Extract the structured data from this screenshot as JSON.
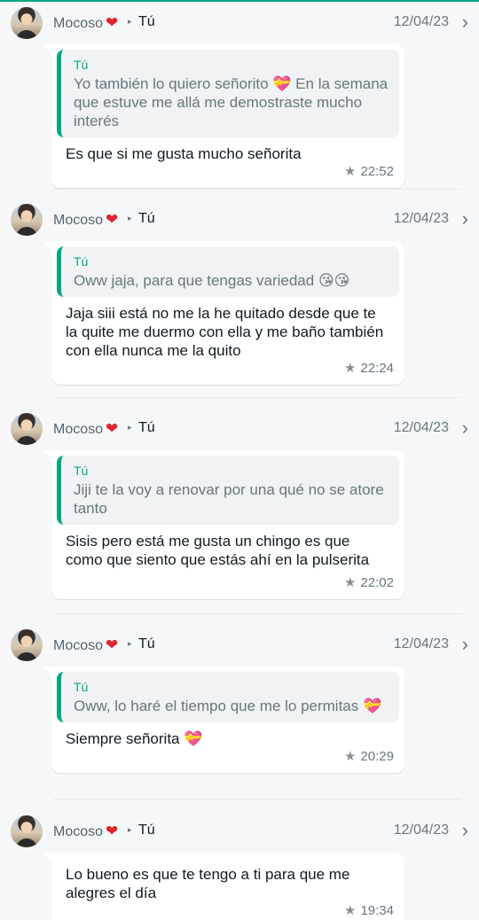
{
  "entries": [
    {
      "sender": "Mocoso",
      "sender_heart": "❤",
      "arrow": "▸",
      "recipient": "Tú",
      "date": "12/04/23",
      "quote_author": "Tú",
      "quote_text": "Yo también lo quiero señorito 💝 En la semana que estuve me allá me demostraste mucho interés",
      "message": "Es que si me gusta mucho señorita",
      "time": "22:52"
    },
    {
      "sender": "Mocoso",
      "sender_heart": "❤",
      "arrow": "▸",
      "recipient": "Tú",
      "date": "12/04/23",
      "quote_author": "Tú",
      "quote_text": "Oww jaja, para que tengas variedad 😘😘",
      "message": "Jaja siii está no me la he quitado desde que te la quite me duermo con ella y me baño también con ella nunca me la quito",
      "time": "22:24"
    },
    {
      "sender": "Mocoso",
      "sender_heart": "❤",
      "arrow": "▸",
      "recipient": "Tú",
      "date": "12/04/23",
      "quote_author": "Tú",
      "quote_text": "Jiji te la voy a renovar por una qué no se atore tanto",
      "message": "Sisis pero está me gusta un chingo es que como que siento que estás ahí en la pulserita",
      "time": "22:02"
    },
    {
      "sender": "Mocoso",
      "sender_heart": "❤",
      "arrow": "▸",
      "recipient": "Tú",
      "date": "12/04/23",
      "quote_author": "Tú",
      "quote_text": "Oww, lo haré el tiempo que me lo permitas 💝",
      "message": "Siempre señorita 💝",
      "time": "20:29"
    },
    {
      "sender": "Mocoso",
      "sender_heart": "❤",
      "arrow": "▸",
      "recipient": "Tú",
      "date": "12/04/23",
      "message": "Lo bueno es que te tengo a ti para que me alegres el día",
      "time": "19:34"
    }
  ],
  "icons": {
    "star": "★",
    "chevron": "›"
  },
  "colors": {
    "accent": "#06a884",
    "heart": "#e0242f",
    "background": "#f6f7f8"
  }
}
